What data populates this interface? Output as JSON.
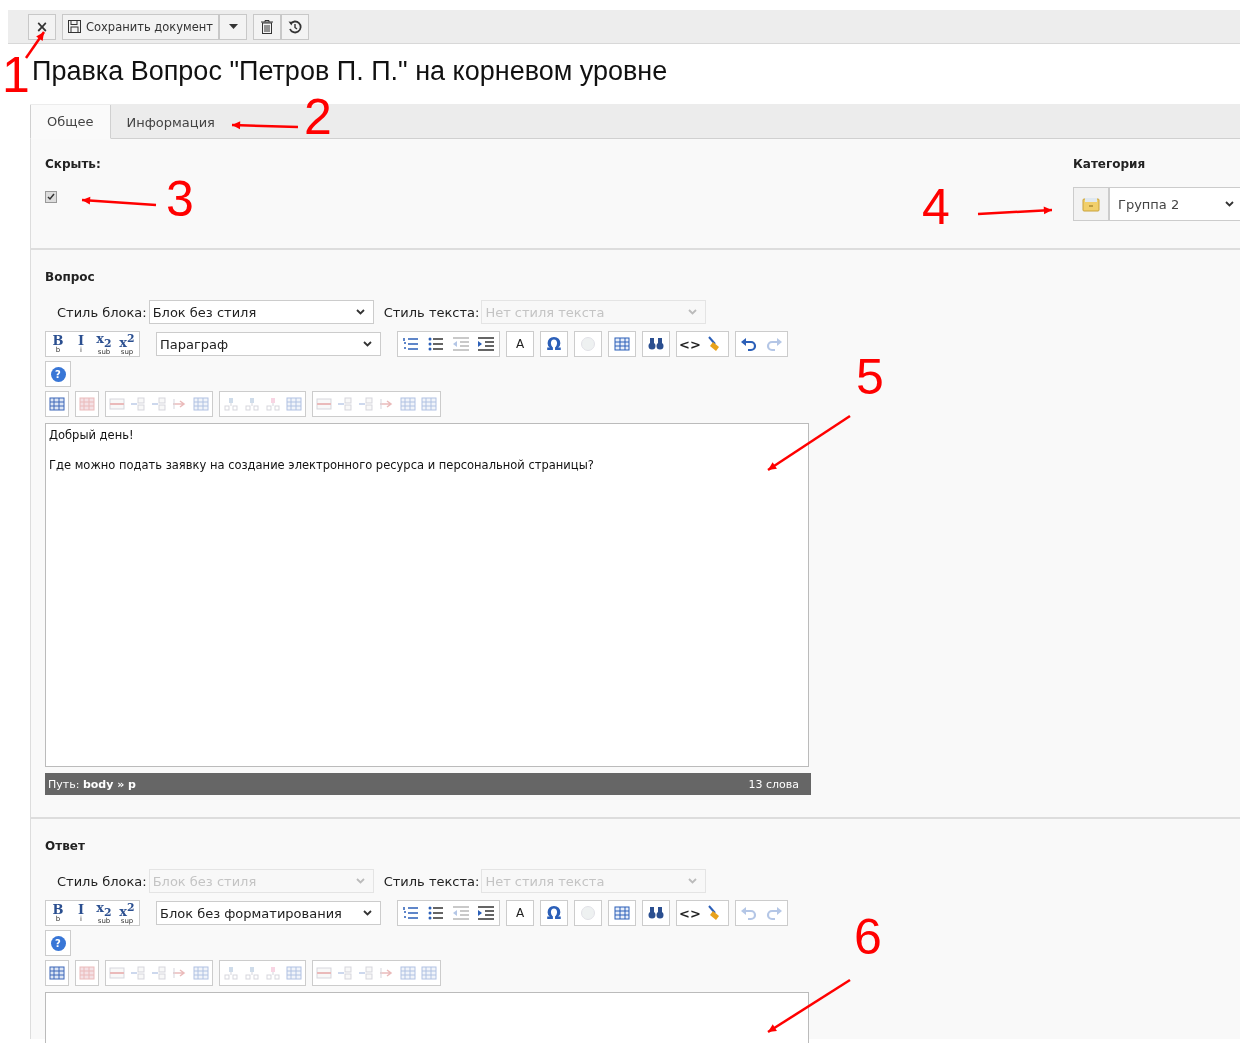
{
  "toolbar": {
    "close_button": "×",
    "save_button": "Сохранить документ"
  },
  "title": "Правка Вопрос \"Петров П. П.\" на корневом уровне",
  "tabs": [
    {
      "label": "Общее",
      "selected": true
    },
    {
      "label": "Информация",
      "selected": false
    }
  ],
  "hide": {
    "label": "Скрыть:",
    "checked": true
  },
  "category": {
    "label": "Категория",
    "value": "Группа 2"
  },
  "editors": [
    {
      "label": "Вопрос",
      "block_style_label": "Стиль блока:",
      "block_style": "Блок без стиля",
      "block_style_disabled": false,
      "text_style_label": "Стиль текста:",
      "text_style": "Нет стиля текста",
      "text_style_disabled": true,
      "format_buttons": [
        {
          "glyph": "B",
          "caption": "b"
        },
        {
          "glyph": "I",
          "caption": "i"
        },
        {
          "glyph": "x$_{2}$",
          "caption": "sub"
        },
        {
          "glyph": "x$^{2}$",
          "caption": "sup"
        }
      ],
      "format": "Параграф",
      "color_button": "A",
      "charmap_button": "Ω",
      "code_button": "<>",
      "undo_disabled": false,
      "redo_disabled": true,
      "help_button": "?",
      "paragraphs": [
        "Добрый день!",
        "Где можно подать заявку на создание электронного ресурса и персональной страницы?"
      ],
      "path": "Путь:  **body » p**",
      "word_count": "13 слова"
    },
    {
      "label": "Ответ",
      "block_style_label": "Стиль блока:",
      "block_style": "Блок без стиля",
      "block_style_disabled": true,
      "text_style_label": "Стиль текста:",
      "text_style": "Нет стиля текста",
      "text_style_disabled": true,
      "format_buttons": [
        {
          "glyph": "B",
          "caption": "b"
        },
        {
          "glyph": "I",
          "caption": "i"
        },
        {
          "glyph": "x$_{2}$",
          "caption": "sub"
        },
        {
          "glyph": "x$^{2}$",
          "caption": "sup"
        }
      ],
      "format": "Блок без форматирования",
      "color_button": "A",
      "charmap_button": "Ω",
      "code_button": "<>",
      "undo_disabled": true,
      "redo_disabled": true,
      "help_button": "?"
    }
  ],
  "annotations": [
    {
      "label": "1"
    },
    {
      "label": "2"
    },
    {
      "label": "3"
    },
    {
      "label": "4"
    },
    {
      "label": "5"
    },
    {
      "label": "6"
    }
  ]
}
